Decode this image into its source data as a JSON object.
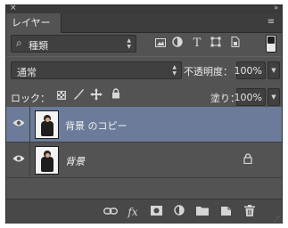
{
  "panel": {
    "close_glyph": "×",
    "collapse_glyph": "»",
    "tab_label": "レイヤー",
    "menu_glyph": "≡"
  },
  "filter": {
    "kind_label": "種類",
    "search_glyph": "⌕",
    "icons": [
      "image-filter-icon",
      "adjustment-filter-icon",
      "type-filter-icon",
      "shape-filter-icon",
      "smart-object-filter-icon"
    ]
  },
  "blend": {
    "mode_label": "通常",
    "opacity_label": "不透明度：",
    "opacity_value": "100%"
  },
  "lock": {
    "label": "ロック：",
    "fill_label": "塗り：",
    "fill_value": "100%"
  },
  "layers": [
    {
      "name": "背景 のコピー",
      "selected": true,
      "visible": true,
      "locked": false
    },
    {
      "name": "背景",
      "selected": false,
      "visible": true,
      "locked": true
    }
  ],
  "footer": {
    "icons": [
      "link-layers-icon",
      "fx-icon",
      "add-mask-icon",
      "new-adjustment-icon",
      "new-group-icon",
      "new-layer-icon",
      "delete-layer-icon"
    ],
    "fx_label": "fx"
  },
  "colors": {
    "panel_bg": "#535353",
    "selected_row": "#6b7b99",
    "field_bg": "#404040"
  }
}
